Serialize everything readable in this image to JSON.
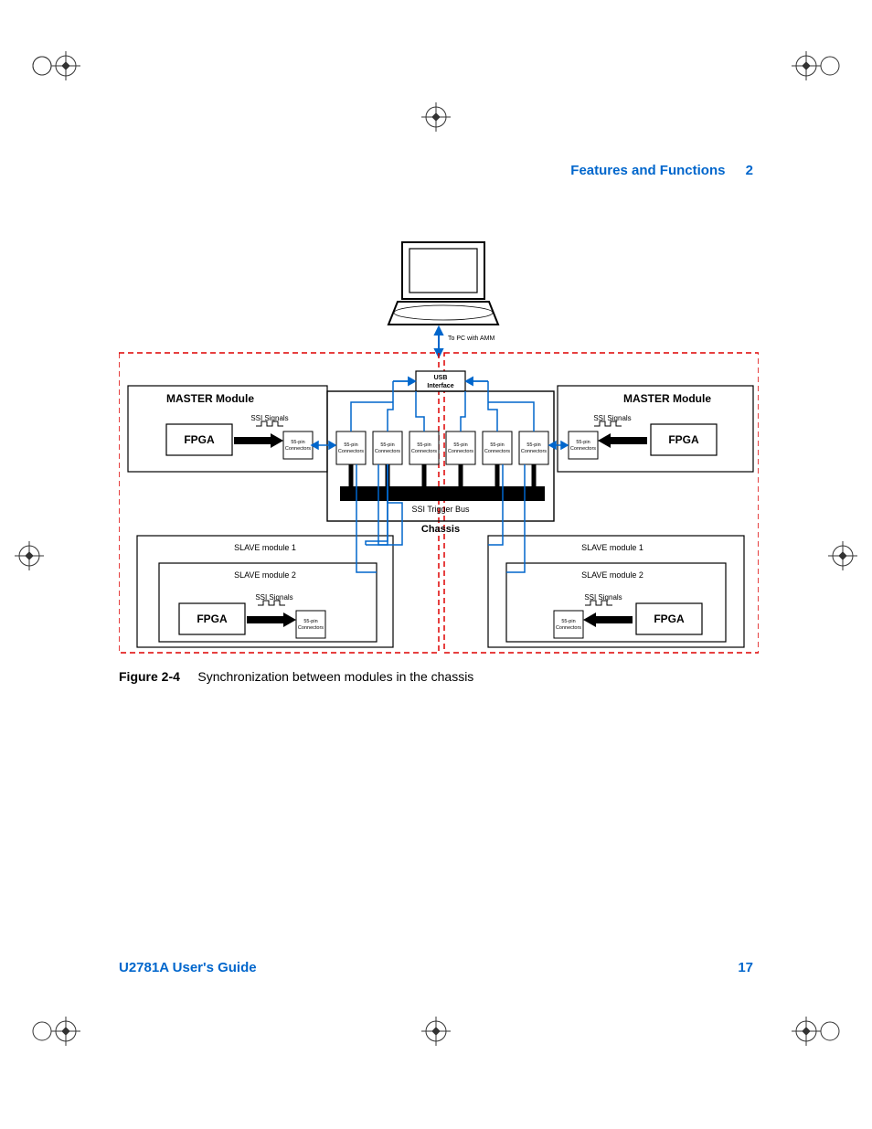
{
  "header": {
    "section_title": "Features and Functions",
    "section_number": "2"
  },
  "footer": {
    "guide": "U2781A User's Guide",
    "page": "17"
  },
  "caption": {
    "label": "Figure 2-4",
    "text": "Synchronization between modules in the chassis"
  },
  "diagram": {
    "to_pc": "To PC with AMM",
    "usb_line1": "USB",
    "usb_line2": "Interface",
    "master_left": "MASTER Module",
    "master_right": "MASTER Module",
    "fpga": "FPGA",
    "ssi_signals": "SSI Signals",
    "conn_line1": "55-pin",
    "conn_line2": "Connectors",
    "ssi_trigger_bus": "SSI Trigger Bus",
    "chassis": "Chassis",
    "slave1": "SLAVE module 1",
    "slave2": "SLAVE module 2"
  }
}
